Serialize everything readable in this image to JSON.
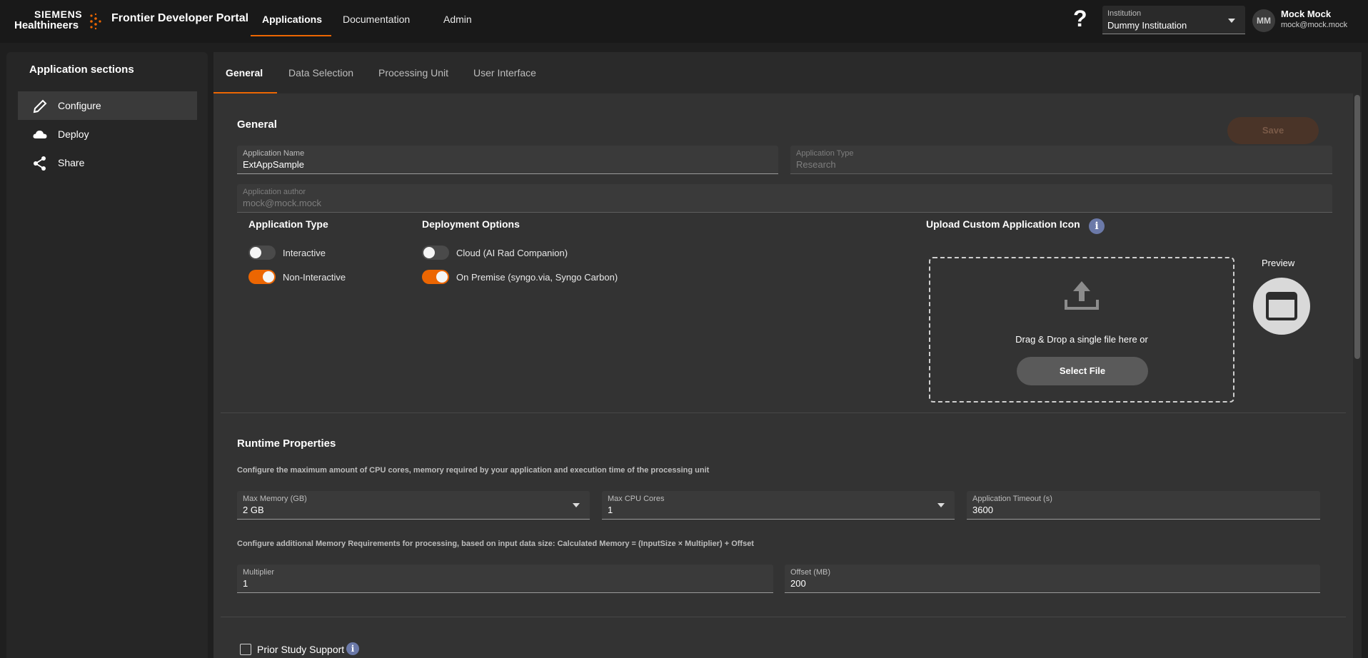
{
  "header": {
    "logo_line1": "SIEMENS",
    "logo_line2": "Healthineers",
    "portal_title": "Frontier Developer Portal",
    "nav": [
      "Applications",
      "Documentation",
      "Admin"
    ],
    "help_glyph": "?",
    "institution": {
      "label": "Institution",
      "value": "Dummy Instituation"
    },
    "user": {
      "initials": "MM",
      "name": "Mock Mock",
      "email": "mock@mock.mock"
    },
    "accent_color": "#ec6602"
  },
  "sidebar": {
    "title": "Application sections",
    "items": [
      {
        "label": "Configure",
        "icon": "pencil-icon",
        "active": true
      },
      {
        "label": "Deploy",
        "icon": "cloud-icon",
        "active": false
      },
      {
        "label": "Share",
        "icon": "share-icon",
        "active": false
      }
    ]
  },
  "tabs": [
    "General",
    "Data Selection",
    "Processing Unit",
    "User Interface"
  ],
  "general": {
    "title": "General",
    "save_label": "Save",
    "app_name": {
      "label": "Application Name",
      "value": "ExtAppSample"
    },
    "app_type_field": {
      "label": "Application Type",
      "value": "Research"
    },
    "app_author": {
      "label": "Application author",
      "value": "mock@mock.mock"
    },
    "application_type": {
      "title": "Application Type",
      "options": [
        {
          "label": "Interactive",
          "on": false
        },
        {
          "label": "Non-Interactive",
          "on": true
        }
      ]
    },
    "deployment_options": {
      "title": "Deployment Options",
      "options": [
        {
          "label": "Cloud (AI Rad Companion)",
          "on": false
        },
        {
          "label": "On Premise (syngo.via, Syngo Carbon)",
          "on": true
        }
      ]
    },
    "upload": {
      "title": "Upload Custom Application Icon",
      "info_glyph": "i",
      "drop_text": "Drag & Drop a single file here or",
      "select_label": "Select File",
      "preview_label": "Preview"
    }
  },
  "runtime": {
    "title": "Runtime Properties",
    "desc1": "Configure the maximum amount of CPU cores, memory required by your application and execution time of the processing unit",
    "max_memory": {
      "label": "Max Memory (GB)",
      "value": "2 GB"
    },
    "max_cpu": {
      "label": "Max CPU Cores",
      "value": "1"
    },
    "timeout": {
      "label": "Application Timeout (s)",
      "value": "3600"
    },
    "desc2": "Configure additional Memory Requirements for processing, based on input data size: Calculated Memory = (InputSize × Multiplier) + Offset",
    "multiplier": {
      "label": "Multiplier",
      "value": "1"
    },
    "offset": {
      "label": "Offset (MB)",
      "value": "200"
    }
  },
  "prior_study": {
    "label": "Prior Study Support",
    "checked": false,
    "info_glyph": "i"
  }
}
